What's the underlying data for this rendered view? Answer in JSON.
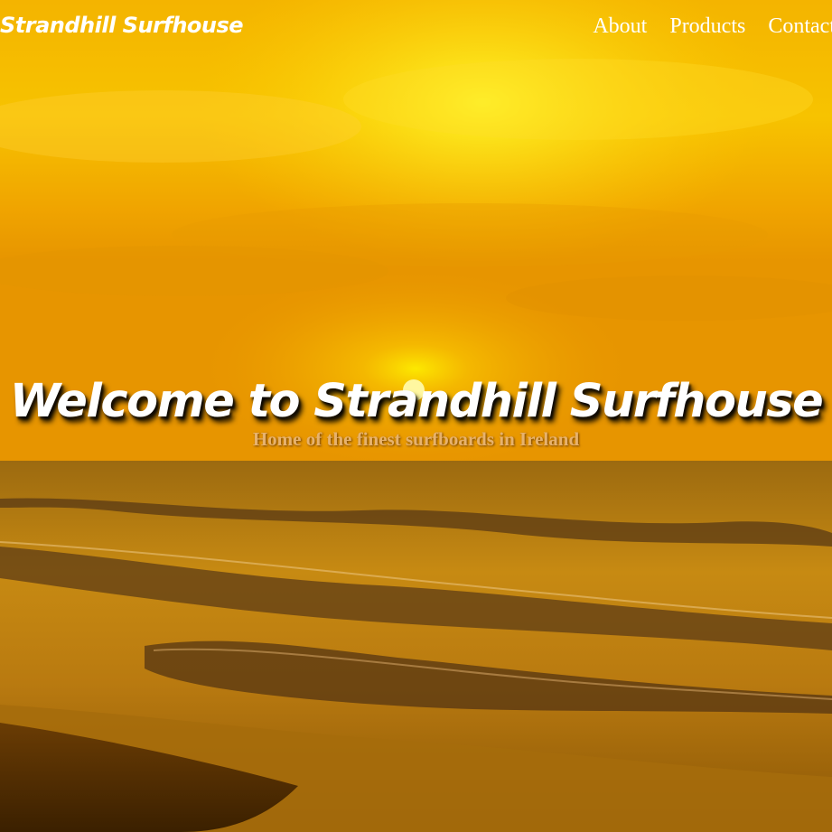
{
  "header": {
    "brand": "Strandhill Surfhouse",
    "nav": [
      {
        "label": "About"
      },
      {
        "label": "Products"
      },
      {
        "label": "Contact"
      }
    ]
  },
  "hero": {
    "title": "Welcome to Strandhill Surfhouse",
    "subtitle": "Home of the finest surfboards in Ireland",
    "background_image": "sunset-beach-waves"
  },
  "colors": {
    "sky_top": "#f2a800",
    "sun": "#ffee00",
    "sea": "#b87a10",
    "sand": "#5a3300",
    "text": "#ffffff",
    "subtitle": "#e7b26d"
  }
}
